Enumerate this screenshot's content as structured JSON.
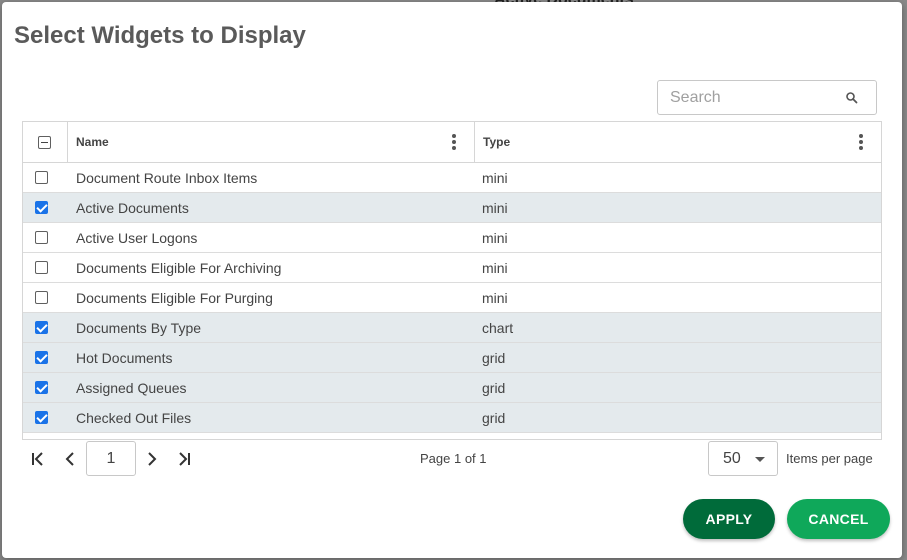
{
  "backdrop": {
    "partial_text": "Active Documents"
  },
  "dialog": {
    "title": "Select Widgets to Display",
    "search": {
      "placeholder": "Search",
      "value": "",
      "icon": "search-icon"
    },
    "grid": {
      "header_checkbox_state": "indeterminate",
      "columns": [
        {
          "label": "Name",
          "menu_icon": "more-vertical-icon"
        },
        {
          "label": "Type",
          "menu_icon": "more-vertical-icon"
        }
      ],
      "rows": [
        {
          "name": "Document Route Inbox Items",
          "type": "mini",
          "checked": false
        },
        {
          "name": "Active Documents",
          "type": "mini",
          "checked": true
        },
        {
          "name": "Active User Logons",
          "type": "mini",
          "checked": false
        },
        {
          "name": "Documents Eligible For Archiving",
          "type": "mini",
          "checked": false
        },
        {
          "name": "Documents Eligible For Purging",
          "type": "mini",
          "checked": false
        },
        {
          "name": "Documents By Type",
          "type": "chart",
          "checked": true
        },
        {
          "name": "Hot Documents",
          "type": "grid",
          "checked": true
        },
        {
          "name": "Assigned Queues",
          "type": "grid",
          "checked": true
        },
        {
          "name": "Checked Out Files",
          "type": "grid",
          "checked": true
        }
      ]
    },
    "pager": {
      "current_page": "1",
      "page_info": "Page 1 of 1",
      "items_per_page": "50",
      "items_per_page_label": "Items per page",
      "icons": [
        "first-page-icon",
        "prev-page-icon",
        "next-page-icon",
        "last-page-icon"
      ]
    },
    "buttons": {
      "apply": "APPLY",
      "cancel": "CANCEL"
    },
    "colors": {
      "apply_bg": "#006b3a",
      "cancel_bg": "#0fa85a",
      "checkbox_checked": "#1a73e8",
      "selected_row_bg": "#e4eaed"
    }
  }
}
